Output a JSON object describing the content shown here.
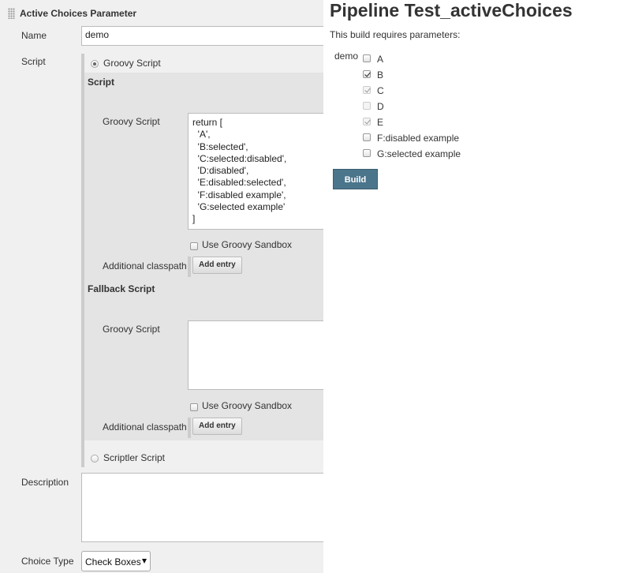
{
  "config": {
    "param_title": "Active Choices Parameter",
    "name_label": "Name",
    "name_value": "demo",
    "script_label": "Script",
    "groovy_option": "Groovy Script",
    "script_heading": "Script",
    "groovy_script_label": "Groovy Script",
    "script_lines": [
      "return [",
      "  'A',",
      "  'B:selected',",
      "  'C:selected:disabled',",
      "  'D:disabled',",
      "  'E:disabled:selected',",
      "  'F:disabled example',",
      "  'G:selected example'",
      "]"
    ],
    "sandbox_label": "Use Groovy Sandbox",
    "classpath_label": "Additional classpath",
    "add_entry_label": "Add entry",
    "fallback_heading": "Fallback Script",
    "fallback_groovy_label": "Groovy Script",
    "fallback_sandbox_label": "Use Groovy Sandbox",
    "fallback_classpath_label": "Additional classpath",
    "fallback_add_entry_label": "Add entry",
    "scriptler_option": "Scriptler Script",
    "description_label": "Description",
    "choice_type_label": "Choice Type",
    "choice_type_value": "Check Boxes"
  },
  "build": {
    "title": "Pipeline Test_activeChoices",
    "subtitle": "This build requires parameters:",
    "param_name": "demo",
    "choices": [
      {
        "label": "A",
        "checked": false,
        "disabled": false
      },
      {
        "label": "B",
        "checked": true,
        "disabled": false
      },
      {
        "label": "C",
        "checked": true,
        "disabled": true
      },
      {
        "label": "D",
        "checked": false,
        "disabled": true
      },
      {
        "label": "E",
        "checked": true,
        "disabled": true
      },
      {
        "label": "F:disabled example",
        "checked": false,
        "disabled": false
      },
      {
        "label": "G:selected example",
        "checked": false,
        "disabled": false
      }
    ],
    "build_button": "Build"
  }
}
